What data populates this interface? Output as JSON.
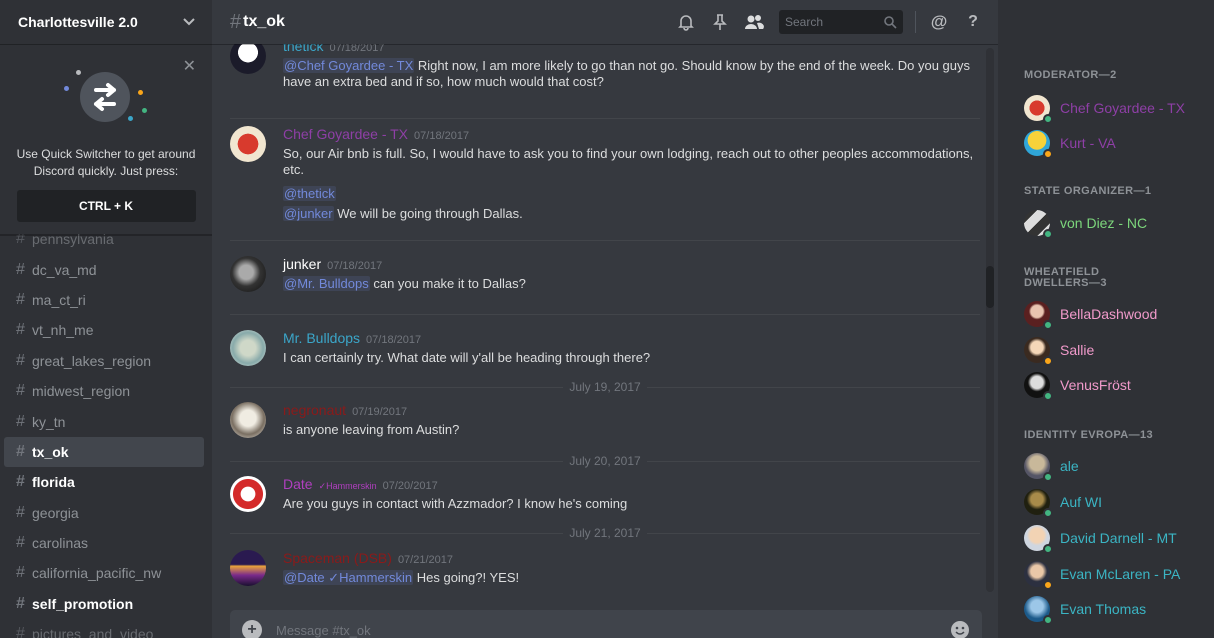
{
  "server": {
    "name": "Charlottesville 2.0"
  },
  "quick_switcher": {
    "text": "Use Quick Switcher to get around Discord quickly. Just press:",
    "shortcut": "CTRL + K"
  },
  "channels": [
    {
      "name": "pennsylvania",
      "state": "clipped"
    },
    {
      "name": "dc_va_md",
      "state": "normal"
    },
    {
      "name": "ma_ct_ri",
      "state": "normal"
    },
    {
      "name": "vt_nh_me",
      "state": "normal"
    },
    {
      "name": "great_lakes_region",
      "state": "normal"
    },
    {
      "name": "midwest_region",
      "state": "normal"
    },
    {
      "name": "ky_tn",
      "state": "normal"
    },
    {
      "name": "tx_ok",
      "state": "active"
    },
    {
      "name": "florida",
      "state": "unread"
    },
    {
      "name": "georgia",
      "state": "normal"
    },
    {
      "name": "carolinas",
      "state": "normal"
    },
    {
      "name": "california_pacific_nw",
      "state": "normal"
    },
    {
      "name": "self_promotion",
      "state": "unread"
    },
    {
      "name": "pictures_and_video",
      "state": "clipped"
    }
  ],
  "channel_header": {
    "name": "tx_ok",
    "search_placeholder": "Search"
  },
  "messages": [
    {
      "author": "thetick",
      "color": "#3ba6c9",
      "time": "07/18/2017",
      "lines": [
        {
          "mention": "@Chef Goyardee - TX",
          "text": " Right now, I am more likely to go than not go. Should know by the end of the week. Do you guys have an extra bed and if so, how much would that cost?"
        }
      ]
    },
    {
      "author": "Chef Goyardee - TX",
      "color": "#8e3fa6",
      "time": "07/18/2017",
      "lines": [
        {
          "mention": "",
          "text": "So, our Air bnb is full. So, I would have to ask you to find your own lodging, reach out to other peoples accommodations, etc."
        },
        {
          "mention": "@thetick",
          "text": ""
        },
        {
          "mention": "@junker",
          "text": " We will be going through Dallas."
        }
      ]
    },
    {
      "author": "junker",
      "color": "#ffffff",
      "time": "07/18/2017",
      "lines": [
        {
          "mention": "@Mr. Bulldops",
          "text": " can you make it to Dallas?"
        }
      ]
    },
    {
      "author": "Mr. Bulldops",
      "color": "#3ba6c9",
      "time": "07/18/2017",
      "lines": [
        {
          "mention": "",
          "text": "I can certainly try. What date will y'all be heading through there?"
        }
      ]
    },
    {
      "author": "negronaut",
      "color": "#8b1a1a",
      "time": "07/19/2017",
      "lines": [
        {
          "mention": "",
          "text": "is anyone leaving from Austin?"
        }
      ]
    },
    {
      "author": "Date",
      "color": "#b03fbf",
      "badge": "✓Hammerskin",
      "time": "07/20/2017",
      "lines": [
        {
          "mention": "",
          "text": "Are you guys in contact with Azzmador? I know he's coming"
        }
      ]
    },
    {
      "author": "Spaceman (DSB)",
      "color": "#8b1a1a",
      "time": "07/21/2017",
      "lines": [
        {
          "mention": "@Date ✓Hammerskin",
          "text": " Hes going?! YES!"
        }
      ]
    }
  ],
  "date_dividers": [
    "July 19, 2017",
    "July 20, 2017",
    "July 21, 2017"
  ],
  "composer": {
    "placeholder": "Message #tx_ok"
  },
  "member_groups": [
    {
      "label": "MODERATOR—2",
      "members": [
        {
          "name": "Chef Goyardee - TX",
          "color": "#8e3fa6",
          "status": "online"
        },
        {
          "name": "Kurt - VA",
          "color": "#8e3fa6",
          "status": "idle"
        }
      ]
    },
    {
      "label": "STATE ORGANIZER—1",
      "members": [
        {
          "name": "von Diez - NC",
          "color": "#7cd67c",
          "status": "online"
        }
      ]
    },
    {
      "label": "WHEATFIELD DWELLERS—3",
      "members": [
        {
          "name": "BellaDashwood",
          "color": "#f19acb",
          "status": "online"
        },
        {
          "name": "Sallie",
          "color": "#f19acb",
          "status": "idle"
        },
        {
          "name": "VenusFröst",
          "color": "#f19acb",
          "status": "online"
        }
      ]
    },
    {
      "label": "IDENTITY EVROPA—13",
      "members": [
        {
          "name": "ale",
          "color": "#3bb5c4",
          "status": "online"
        },
        {
          "name": "Auf WI",
          "color": "#3bb5c4",
          "status": "online"
        },
        {
          "name": "David Darnell - MT",
          "color": "#3bb5c4",
          "status": "online"
        },
        {
          "name": "Evan McLaren - PA",
          "color": "#3bb5c4",
          "status": "idle"
        },
        {
          "name": "Evan Thomas",
          "color": "#3bb5c4",
          "status": "online"
        }
      ]
    }
  ],
  "colors": {
    "online": "#43b581",
    "idle": "#faa61a",
    "mention": "#7289da"
  }
}
